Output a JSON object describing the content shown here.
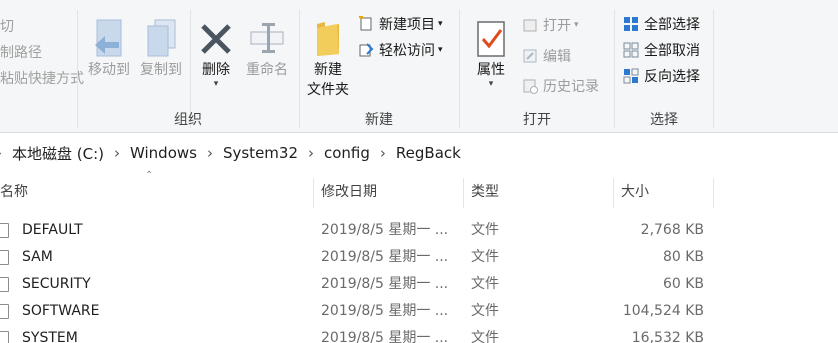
{
  "ribbon": {
    "clipboard_cut": [
      "切",
      "制路径",
      "粘贴快捷方式"
    ],
    "organize": {
      "label": "组织",
      "move_to": "移动到",
      "copy_to": "复制到",
      "delete": "删除",
      "rename": "重命名"
    },
    "new": {
      "label": "新建",
      "new_folder_line1": "新建",
      "new_folder_line2": "文件夹",
      "new_item": "新建项目",
      "easy_access": "轻松访问"
    },
    "open": {
      "label": "打开",
      "properties": "属性",
      "open": "打开",
      "edit": "编辑",
      "history": "历史记录"
    },
    "select": {
      "label": "选择",
      "select_all": "全部选择",
      "select_none": "全部取消",
      "invert": "反向选择"
    }
  },
  "address": {
    "crumbs": [
      "本地磁盘 (C:)",
      "Windows",
      "System32",
      "config",
      "RegBack"
    ]
  },
  "columns": {
    "name": "名称",
    "modified": "修改日期",
    "type": "类型",
    "size": "大小"
  },
  "files": [
    {
      "name": "DEFAULT",
      "date": "2019/8/5 星期一 ...",
      "type": "文件",
      "size": "2,768 KB"
    },
    {
      "name": "SAM",
      "date": "2019/8/5 星期一 ...",
      "type": "文件",
      "size": "80 KB"
    },
    {
      "name": "SECURITY",
      "date": "2019/8/5 星期一 ...",
      "type": "文件",
      "size": "60 KB"
    },
    {
      "name": "SOFTWARE",
      "date": "2019/8/5 星期一 ...",
      "type": "文件",
      "size": "104,524 KB"
    },
    {
      "name": "SYSTEM",
      "date": "2019/8/5 星期一 ...",
      "type": "文件",
      "size": "16,532 KB"
    }
  ],
  "colors": {
    "ribbon_bg": "#f5f6f7",
    "accent": "#2b79d0",
    "disabled": "#9c9c9c",
    "folder": "#e8b940"
  }
}
